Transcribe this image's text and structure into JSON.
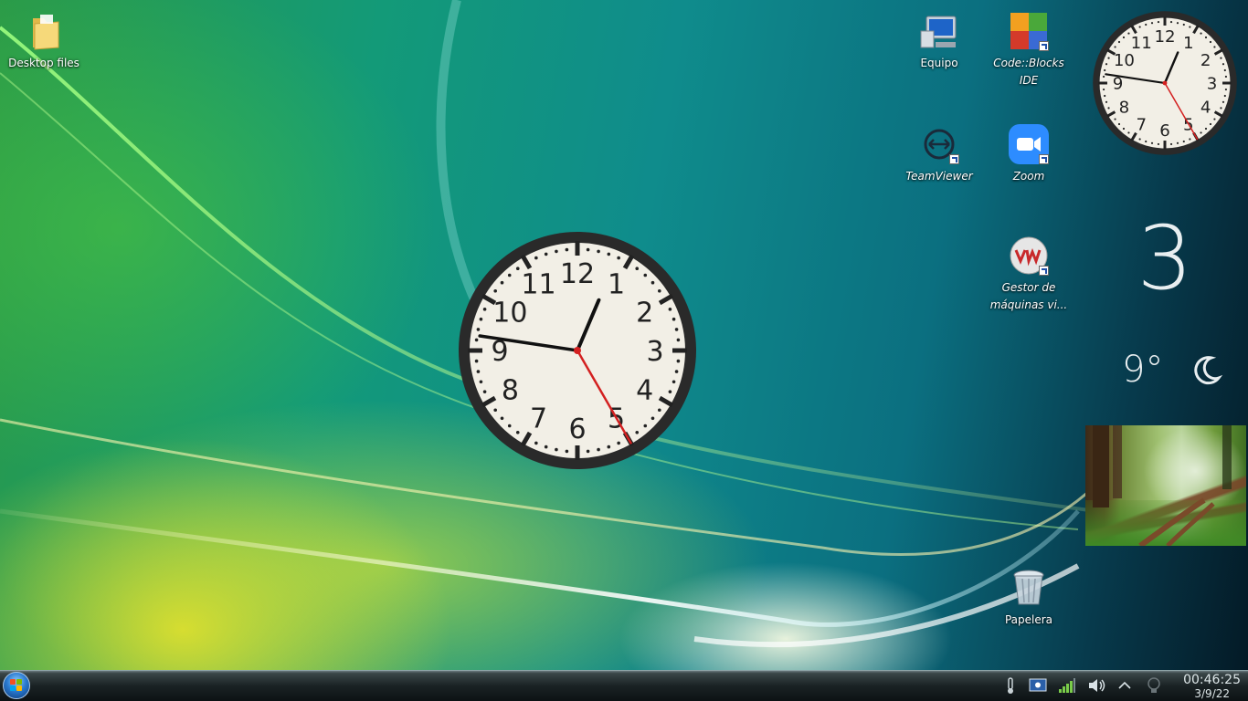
{
  "desktop": {
    "icons": [
      {
        "label": "Desktop files",
        "icon": "folder-icon"
      },
      {
        "label": "Equipo",
        "icon": "computer-icon"
      },
      {
        "label": "Code::Blocks IDE",
        "icon": "codeblocks-icon"
      },
      {
        "label": "TeamViewer",
        "icon": "teamviewer-icon"
      },
      {
        "label": "Zoom",
        "icon": "zoom-icon"
      },
      {
        "label": "Gestor de máquinas vi...",
        "icon": "virt-manager-icon"
      },
      {
        "label": "Papelera",
        "icon": "recycle-bin-icon"
      }
    ]
  },
  "widgets": {
    "analog_clock_large": {
      "hour": 0,
      "minute": 46,
      "second": 25
    },
    "analog_clock_small": {
      "hour": 0,
      "minute": 46,
      "second": 25
    },
    "clock_numerals": [
      "12",
      "1",
      "2",
      "3",
      "4",
      "5",
      "6",
      "7",
      "8",
      "9",
      "10",
      "11"
    ],
    "day_number": "3",
    "weather": {
      "temperature": "9°",
      "icon": "moon-icon"
    },
    "photo_frame": {
      "subject": "forest-path-photo"
    }
  },
  "taskbar": {
    "start_icon": "start-orb-icon",
    "tray": [
      {
        "name": "thermometer-icon"
      },
      {
        "name": "display-settings-icon"
      },
      {
        "name": "network-signal-icon"
      },
      {
        "name": "volume-icon"
      },
      {
        "name": "show-hidden-icons-chevron-icon"
      },
      {
        "name": "lightbulb-icon"
      }
    ],
    "time": "00:46:25",
    "date": "3/9/22"
  },
  "colors": {
    "clock_face": "#f2efe6",
    "clock_bezel": "#2a2a2a",
    "second_hand": "#d32020",
    "text": "#ffffff"
  }
}
